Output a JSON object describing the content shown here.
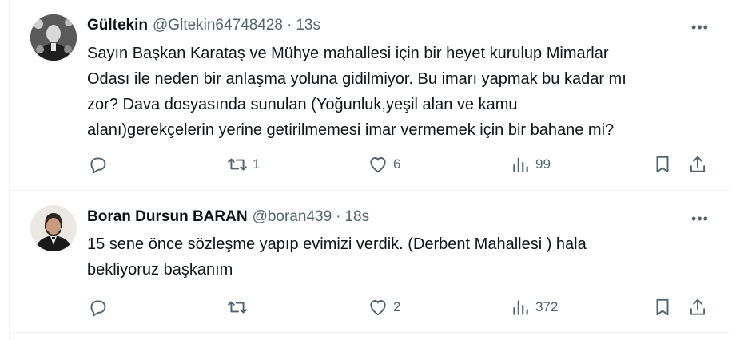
{
  "tweets": [
    {
      "author_name": "Gültekin",
      "handle": "@Gltekin64748428",
      "dot": "·",
      "time": "13s",
      "more_label": "•••",
      "lines": [
        "Sayın Başkan Karataş ve Mühye mahallesi için bir heyet kurulup Mimarlar",
        "Odası ile neden bir anlaşma yoluna gidilmiyor. Bu imarı yapmak bu kadar mı",
        "zor? Dava dosyasında sunulan (Yoğunluk,yeşil alan ve kamu",
        "alanı)gerekçelerin yerine getirilmemesi imar vermemek için bir bahane mi?"
      ],
      "replies": "",
      "retweets": "1",
      "likes": "6",
      "views": "99"
    },
    {
      "author_name": "Boran Dursun BARAN",
      "handle": "@boran439",
      "dot": "·",
      "time": "18s",
      "more_label": "•••",
      "lines": [
        "15 sene önce sözleşme yapıp evimizi verdik. (Derbent Mahallesi ) hala",
        "bekliyoruz başkanım"
      ],
      "replies": "",
      "retweets": "",
      "likes": "2",
      "views": "372"
    }
  ],
  "colors": {
    "text": "#0f1419",
    "secondary": "#536471",
    "border": "#eff3f4"
  },
  "icons": [
    "reply-icon",
    "retweet-icon",
    "like-icon",
    "views-icon",
    "bookmark-icon",
    "share-icon"
  ]
}
